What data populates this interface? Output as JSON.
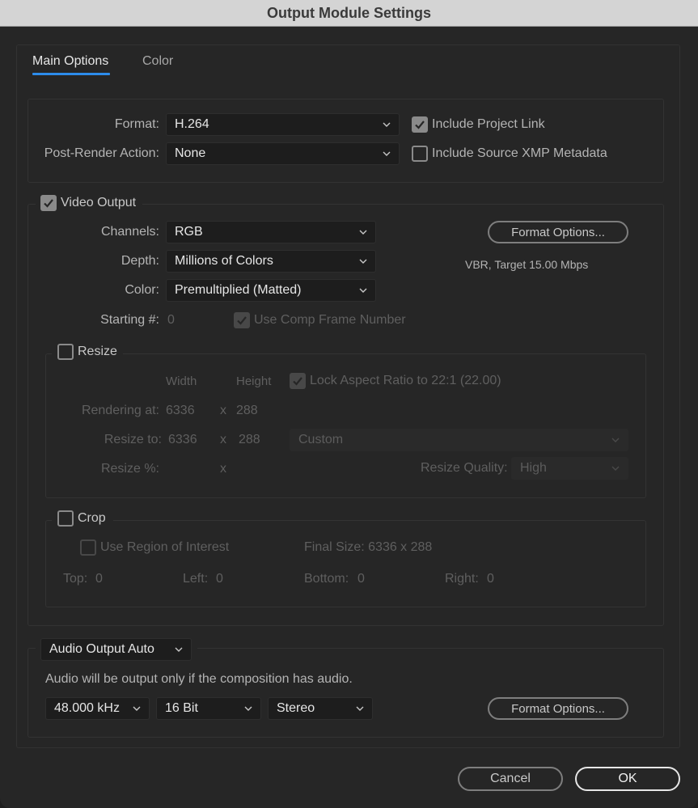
{
  "window": {
    "title": "Output Module Settings"
  },
  "tabs": [
    {
      "label": "Main Options",
      "active": true
    },
    {
      "label": "Color",
      "active": false
    }
  ],
  "general": {
    "format_label": "Format:",
    "format_value": "H.264",
    "post_render_label": "Post-Render Action:",
    "post_render_value": "None",
    "include_project_link": {
      "label": "Include Project Link",
      "checked": true
    },
    "include_xmp": {
      "label": "Include Source XMP Metadata",
      "checked": false
    }
  },
  "video_output": {
    "label": "Video Output",
    "checked": true,
    "channels_label": "Channels:",
    "channels_value": "RGB",
    "depth_label": "Depth:",
    "depth_value": "Millions of Colors",
    "color_label": "Color:",
    "color_value": "Premultiplied (Matted)",
    "starting_label": "Starting #:",
    "starting_value": "0",
    "use_comp_frame": {
      "label": "Use Comp Frame Number",
      "checked": true,
      "disabled": true
    },
    "format_options_label": "Format Options...",
    "codec_info": "VBR, Target 15.00 Mbps"
  },
  "resize": {
    "label": "Resize",
    "checked": false,
    "width_header": "Width",
    "height_header": "Height",
    "lock_aspect": {
      "label": "Lock Aspect Ratio to 22:1 (22.00)",
      "checked": true,
      "disabled": true
    },
    "rendering_at_label": "Rendering at:",
    "rendering_width": "6336",
    "rendering_x": "x",
    "rendering_height": "288",
    "resize_to_label": "Resize to:",
    "resize_width": "6336",
    "resize_x": "x",
    "resize_height": "288",
    "preset_value": "Custom",
    "resize_pct_label": "Resize %:",
    "resize_pct_x": "x",
    "quality_label": "Resize Quality:",
    "quality_value": "High"
  },
  "crop": {
    "label": "Crop",
    "checked": false,
    "use_roi": {
      "label": "Use Region of Interest",
      "checked": false,
      "disabled": true
    },
    "final_size": "Final Size: 6336 x 288",
    "top_label": "Top:",
    "top_value": "0",
    "left_label": "Left:",
    "left_value": "0",
    "bottom_label": "Bottom:",
    "bottom_value": "0",
    "right_label": "Right:",
    "right_value": "0"
  },
  "audio": {
    "mode_value": "Audio Output Auto",
    "note": "Audio will be output only if the composition has audio.",
    "sample_rate": "48.000 kHz",
    "bit_depth": "16 Bit",
    "channels": "Stereo",
    "format_options_label": "Format Options..."
  },
  "footer": {
    "cancel_label": "Cancel",
    "ok_label": "OK"
  },
  "colors": {
    "accent": "#2d8ceb",
    "background": "#262626",
    "titlebar": "#d4d4d4"
  }
}
